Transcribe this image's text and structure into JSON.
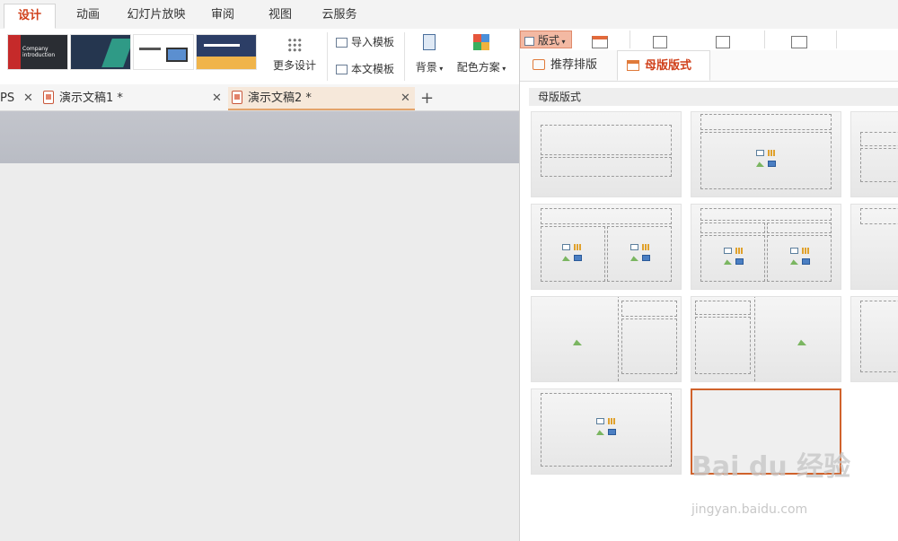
{
  "menu": {
    "tabs": [
      "设计",
      "动画",
      "幻灯片放映",
      "审阅",
      "视图",
      "云服务"
    ]
  },
  "ribbon": {
    "more_design": "更多设计",
    "import_template": "导入模板",
    "text_template": "本文模板",
    "background": "背景",
    "color_scheme": "配色方案",
    "thumb1_text": "Company introduction"
  },
  "panel_ribbon": {
    "layout_btn": "版式"
  },
  "doc_tabs": {
    "wps_fragment": "PS",
    "doc1": "演示文稿1 *",
    "doc2": "演示文稿2 *",
    "add": "+"
  },
  "panel": {
    "tab_recommend": "推荐排版",
    "tab_master": "母版版式",
    "section_title": "母版版式"
  },
  "watermark": {
    "logo": "Bai du 经验",
    "url": "jingyan.baidu.com"
  },
  "colors": {
    "accent": "#d0401b",
    "selection_border": "#d0622b"
  }
}
